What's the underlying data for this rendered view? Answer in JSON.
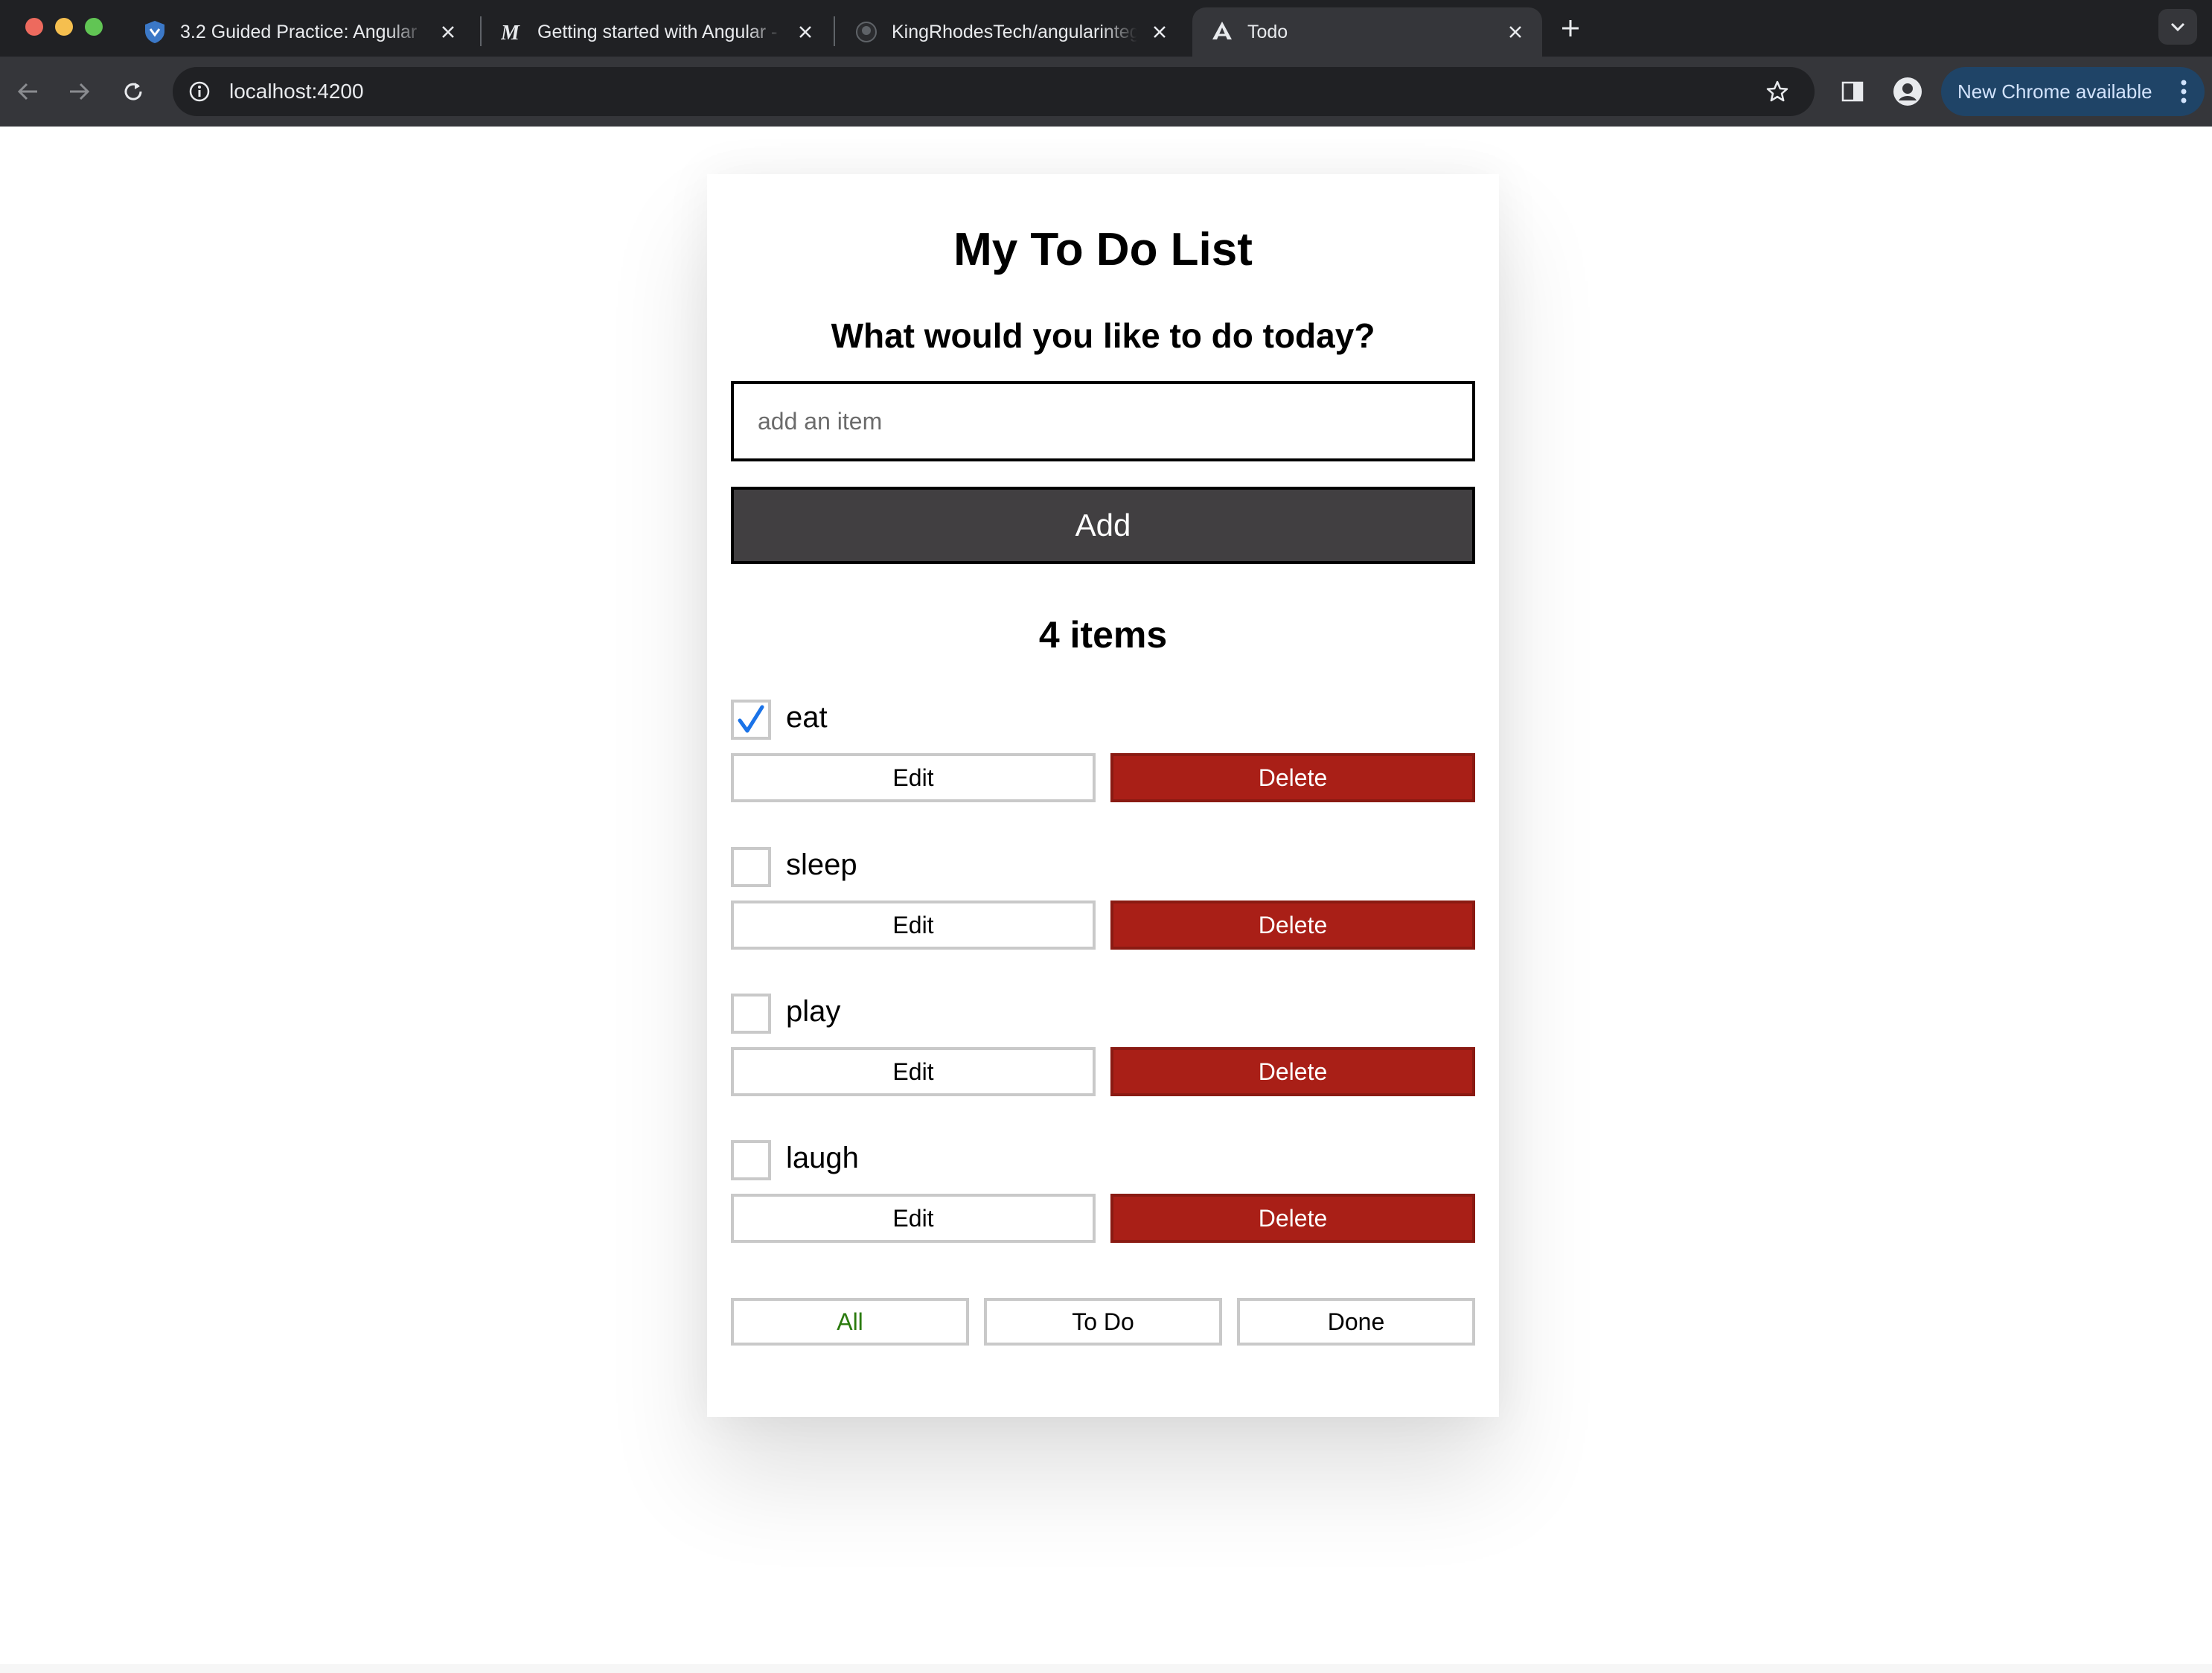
{
  "browser": {
    "tabs": [
      {
        "title": "3.2 Guided Practice: Angular",
        "favicon": "shield-icon"
      },
      {
        "title": "Getting started with Angular - Learn web development | MDN",
        "favicon": "mdn-icon"
      },
      {
        "title": "KingRhodesTech/angularintegration",
        "favicon": "github-icon"
      },
      {
        "title": "Todo",
        "favicon": "angular-icon",
        "active": true
      }
    ],
    "address": "localhost:4200",
    "update_chip": "New Chrome available",
    "colors": {
      "tabstrip": "#202124",
      "toolbar": "#35363a",
      "chip": "#1f4467"
    }
  },
  "app": {
    "title": "My To Do List",
    "subtitle": "What would you like to do today?",
    "input_placeholder": "add an item",
    "add_label": "Add",
    "count_label": "4 items",
    "items": [
      {
        "label": "eat",
        "done": true
      },
      {
        "label": "sleep",
        "done": false
      },
      {
        "label": "play",
        "done": false
      },
      {
        "label": "laugh",
        "done": false
      }
    ],
    "edit_label": "Edit",
    "delete_label": "Delete",
    "filters": [
      {
        "label": "All",
        "selected": true
      },
      {
        "label": "To Do",
        "selected": false
      },
      {
        "label": "Done",
        "selected": false
      }
    ],
    "colors": {
      "add_button": "#413f41",
      "delete_button": "#a91f17",
      "filter_selected": "#2a7a0d",
      "checkmark": "#1a73e8"
    }
  }
}
